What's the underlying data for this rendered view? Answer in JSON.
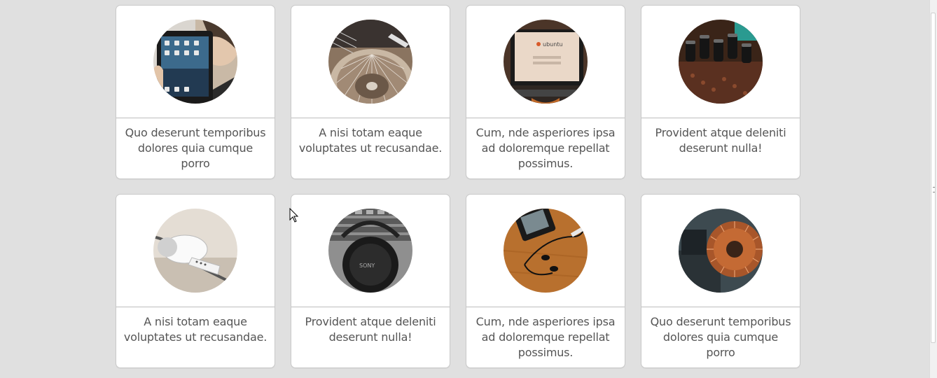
{
  "cards": [
    {
      "image": "tablet-photo",
      "caption": "Quo deserunt temporibus dolores quia cumque porro"
    },
    {
      "image": "turntable-photo",
      "caption": "A nisi totam eaque voluptates ut recusandae."
    },
    {
      "image": "ubuntu-laptop-photo",
      "caption": "Cum, nde asperiores ipsa ad doloremque repellat possimus."
    },
    {
      "image": "circuit-board-photo",
      "caption": "Provident atque deleniti deserunt nulla!"
    },
    {
      "image": "earbuds-photo",
      "caption": "A nisi totam eaque voluptates ut recusandae."
    },
    {
      "image": "headphones-photo",
      "caption": "Provident atque deleniti deserunt nulla!"
    },
    {
      "image": "earphones-on-desk-photo",
      "caption": "Cum, nde asperiores ipsa ad doloremque repellat possimus."
    },
    {
      "image": "copper-coil-photo",
      "caption": "Quo deserunt temporibus dolores quia cumque porro"
    }
  ],
  "ubuntu_label": "ubuntu",
  "headphones_brand": "SONY",
  "colors": {
    "background": "#e0e0e0",
    "card": "#ffffff",
    "caption_text": "#555555",
    "divider": "#bdbdbd"
  }
}
